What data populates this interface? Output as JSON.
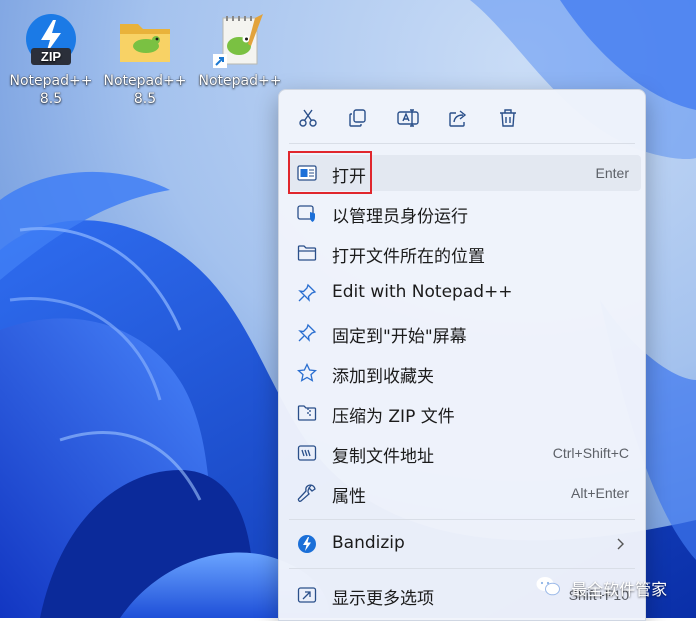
{
  "desktop": {
    "icons": [
      {
        "label_line1": "Notepad++",
        "label_line2": "8.5",
        "badge": "ZIP",
        "icon": "bandizip-zip-icon"
      },
      {
        "label_line1": "Notepad++",
        "label_line2": "8.5",
        "icon": "folder-icon"
      },
      {
        "label_line1": "Notepad++",
        "label_line2": "",
        "icon": "notepadpp-shortcut-icon"
      }
    ]
  },
  "context_menu": {
    "toolbar": [
      "cut-icon",
      "copy-icon",
      "rename-icon",
      "share-icon",
      "delete-icon"
    ],
    "items": [
      {
        "label": "打开",
        "shortcut": "Enter",
        "icon": "open-app-icon"
      },
      {
        "label": "以管理员身份运行",
        "shortcut": "",
        "icon": "admin-shield-icon"
      },
      {
        "label": "打开文件所在的位置",
        "shortcut": "",
        "icon": "folder-outline-icon"
      },
      {
        "label": "Edit with Notepad++",
        "shortcut": "",
        "icon": "pin-icon"
      },
      {
        "label": "固定到\"开始\"屏幕",
        "shortcut": "",
        "icon": "pin-icon"
      },
      {
        "label": "添加到收藏夹",
        "shortcut": "",
        "icon": "star-icon"
      },
      {
        "label": "压缩为 ZIP 文件",
        "shortcut": "",
        "icon": "zip-folder-icon"
      },
      {
        "label": "复制文件地址",
        "shortcut": "Ctrl+Shift+C",
        "icon": "copy-path-icon"
      },
      {
        "label": "属性",
        "shortcut": "Alt+Enter",
        "icon": "wrench-icon"
      }
    ],
    "bandizip": {
      "label": "Bandizip",
      "icon": "bandizip-icon",
      "arrow": "chevron-right-icon"
    },
    "more": {
      "label": "显示更多选项",
      "shortcut": "Shift+F10",
      "icon": "more-options-icon"
    }
  },
  "watermark": {
    "text": "最全软件管家",
    "icon": "wechat-icon"
  },
  "colors": {
    "accent": "#0067c0",
    "highlight_box": "#e0262d",
    "menu_bg": "#f1f4fb"
  }
}
